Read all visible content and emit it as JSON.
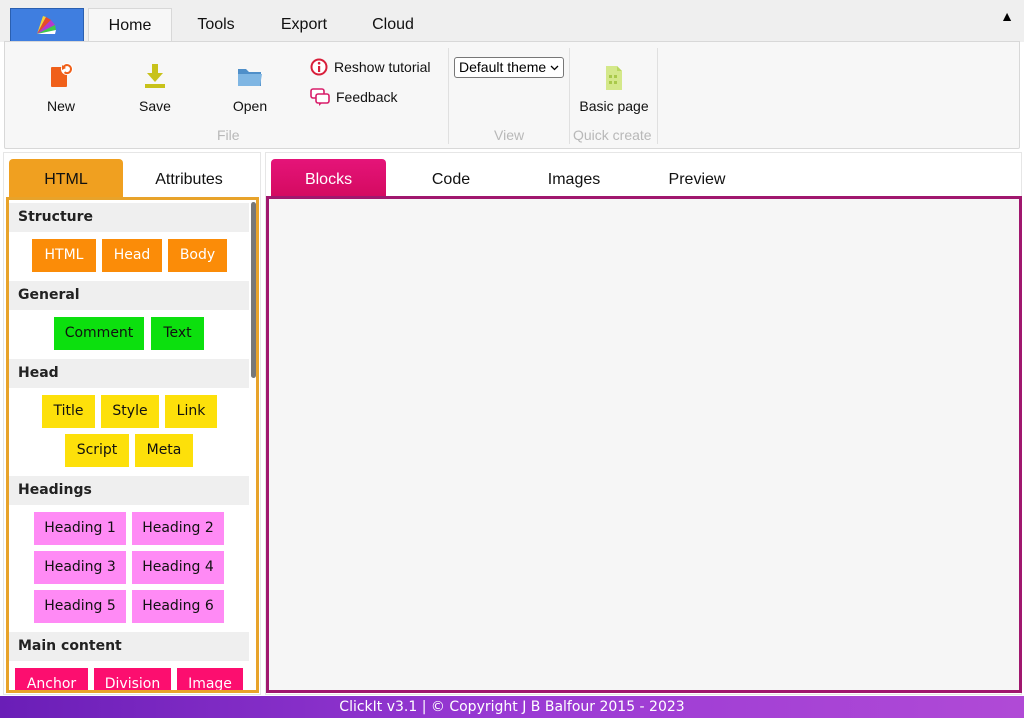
{
  "ribbon": {
    "tabs": [
      "Home",
      "Tools",
      "Export",
      "Cloud"
    ],
    "collapse_symbol": "▲",
    "file": {
      "new_label": "New",
      "save_label": "Save",
      "open_label": "Open",
      "reshow_label": "Reshow tutorial",
      "feedback_label": "Feedback",
      "group_label": "File"
    },
    "view": {
      "theme_value": "Default theme",
      "group_label": "View"
    },
    "quick": {
      "basic_page_label": "Basic page",
      "group_label": "Quick create"
    }
  },
  "left_pane": {
    "tabs": [
      "HTML",
      "Attributes"
    ],
    "sections": [
      {
        "title": "Structure",
        "blocks": [
          "HTML",
          "Head",
          "Body"
        ]
      },
      {
        "title": "General",
        "blocks": [
          "Comment",
          "Text"
        ]
      },
      {
        "title": "Head",
        "blocks": [
          "Title",
          "Style",
          "Link",
          "Script",
          "Meta"
        ]
      },
      {
        "title": "Headings",
        "blocks": [
          "Heading 1",
          "Heading 2",
          "Heading 3",
          "Heading 4",
          "Heading 5",
          "Heading 6"
        ]
      },
      {
        "title": "Main content",
        "blocks": [
          "Anchor",
          "Division",
          "Image"
        ]
      }
    ]
  },
  "right_pane": {
    "tabs": [
      "Blocks",
      "Code",
      "Images",
      "Preview"
    ]
  },
  "footer": {
    "text": "ClickIt v3.1 | © Copyright J B Balfour 2015 - 2023"
  },
  "colors": {
    "structure": "#fb8c08",
    "general": "#0ce00e",
    "head": "#fde00a",
    "headings": "#ff8af5",
    "main_content": "#fc0e6f",
    "workspace_border": "#a0176e",
    "html_tab": "#f0a020",
    "blocks_tab": "#e0106a"
  },
  "icons": [
    "app-logo",
    "new-file-icon",
    "save-icon",
    "open-folder-icon",
    "info-icon",
    "feedback-icon",
    "basic-page-icon",
    "chevron-down-icon"
  ]
}
